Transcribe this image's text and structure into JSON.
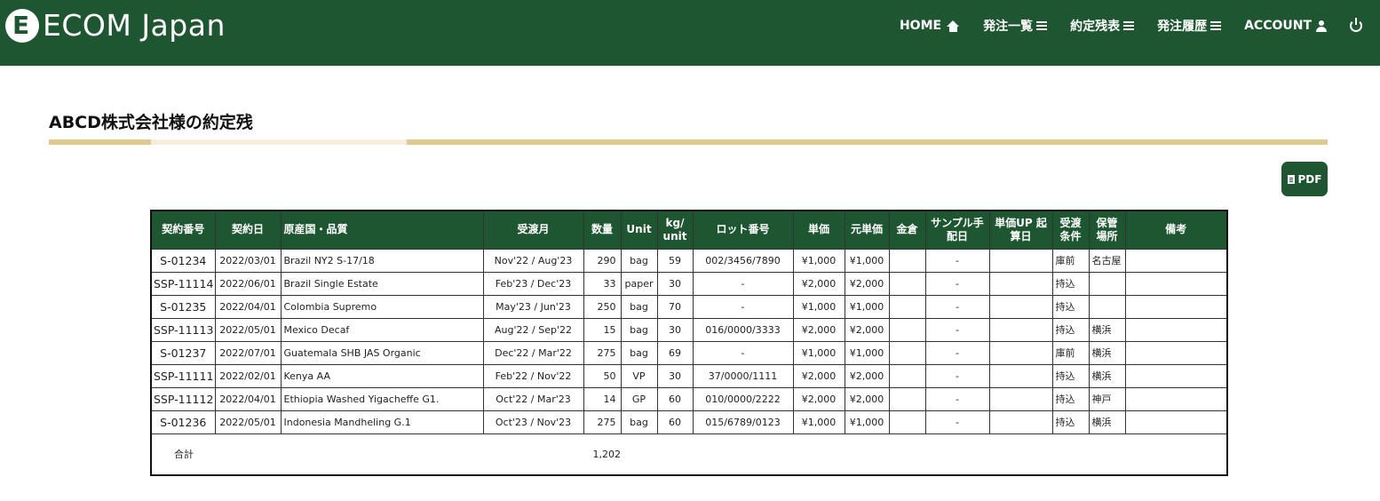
{
  "header": {
    "logo_text": "ECOM Japan",
    "nav": [
      {
        "label": "HOME",
        "icon": "home-icon"
      },
      {
        "label": "発注一覧",
        "icon": "menu-icon"
      },
      {
        "label": "約定残表",
        "icon": "menu-icon"
      },
      {
        "label": "発注履歴",
        "icon": "menu-icon"
      },
      {
        "label": "ACCOUNT",
        "icon": "user-icon"
      },
      {
        "label": "",
        "icon": "power-icon"
      }
    ]
  },
  "colors": {
    "brand": "#1e5631",
    "accent": "#e0c990",
    "accent_light": "#f5eedc"
  },
  "page": {
    "title": "ABCD株式会社様の約定残"
  },
  "pdf_button": {
    "label": "PDF",
    "icon": "pdf-file-icon"
  },
  "table": {
    "headers": [
      "契約番号",
      "契約日",
      "原産国・品質",
      "受渡月",
      "数量",
      "Unit",
      "kg/ unit",
      "ロット番号",
      "単価",
      "元単価",
      "金倉",
      "サンプル手 配日",
      "単価UP 起算日",
      "受渡 条件",
      "保管 場所",
      "備考"
    ],
    "rows": [
      [
        "S-01234",
        "2022/03/01",
        "Brazil NY2 S-17/18",
        "Nov'22 / Aug'23",
        "290",
        "bag",
        "59",
        "002/3456/7890",
        "¥1,000",
        "¥1,000",
        "",
        "-",
        "",
        "庫前",
        "名古屋",
        ""
      ],
      [
        "SSP-11114",
        "2022/06/01",
        "Brazil Single Estate",
        "Feb'23 / Dec'23",
        "33",
        "paper",
        "30",
        "-",
        "¥2,000",
        "¥2,000",
        "",
        "-",
        "",
        "持込",
        "",
        ""
      ],
      [
        "S-01235",
        "2022/04/01",
        "Colombia Supremo",
        "May'23 / Jun'23",
        "250",
        "bag",
        "70",
        "-",
        "¥1,000",
        "¥1,000",
        "",
        "-",
        "",
        "持込",
        "",
        ""
      ],
      [
        "SSP-11113",
        "2022/05/01",
        "Mexico Decaf",
        "Aug'22 / Sep'22",
        "15",
        "bag",
        "30",
        "016/0000/3333",
        "¥2,000",
        "¥2,000",
        "",
        "-",
        "",
        "持込",
        "横浜",
        ""
      ],
      [
        "S-01237",
        "2022/07/01",
        "Guatemala SHB JAS Organic",
        "Dec'22 / Mar'22",
        "275",
        "bag",
        "69",
        "-",
        "¥1,000",
        "¥1,000",
        "",
        "-",
        "",
        "庫前",
        "横浜",
        ""
      ],
      [
        "SSP-11111",
        "2022/02/01",
        "Kenya AA",
        "Feb'22 / Nov'22",
        "50",
        "VP",
        "30",
        "37/0000/1111",
        "¥2,000",
        "¥2,000",
        "",
        "-",
        "",
        "持込",
        "横浜",
        ""
      ],
      [
        "SSP-11112",
        "2022/04/01",
        "Ethiopia Washed Yigacheffe G1.",
        "Oct'22 / Mar'23",
        "14",
        "GP",
        "60",
        "010/0000/2222",
        "¥2,000",
        "¥2,000",
        "",
        "-",
        "",
        "持込",
        "神戸",
        ""
      ],
      [
        "S-01236",
        "2022/05/01",
        "Indonesia Mandheling G.1",
        "Oct'23 / Nov'23",
        "275",
        "bag",
        "60",
        "015/6789/0123",
        "¥1,000",
        "¥1,000",
        "",
        "-",
        "",
        "持込",
        "横浜",
        ""
      ]
    ],
    "total_label": "合計",
    "total_quantity": "1,202"
  }
}
